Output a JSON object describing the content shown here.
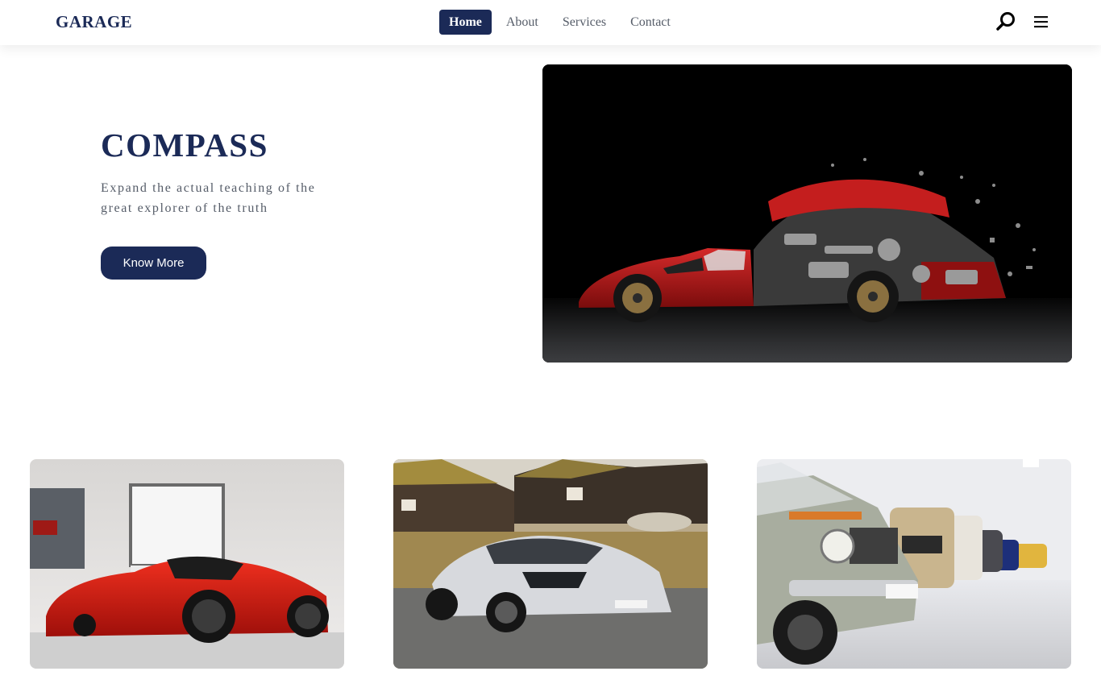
{
  "brand": {
    "logo": "GARAGE"
  },
  "nav": {
    "items": [
      {
        "label": "Home",
        "active": true
      },
      {
        "label": "About",
        "active": false
      },
      {
        "label": "Services",
        "active": false
      },
      {
        "label": "Contact",
        "active": false
      }
    ],
    "icons": [
      "search-icon",
      "menu-icon"
    ]
  },
  "hero": {
    "title": "COMPASS",
    "subtitle_line1": "Expand the actual teaching of the",
    "subtitle_line2": "great explorer of the truth",
    "button_label": "Know More",
    "image": "exploded-red-race-car-photo"
  },
  "gallery": {
    "cards": [
      {
        "image": "red-supercar-showroom-photo"
      },
      {
        "image": "silver-supercar-village-photo"
      },
      {
        "image": "classic-cars-row-museum-photo"
      }
    ]
  },
  "colors": {
    "primary": "#1b2a57",
    "text_muted": "#555c68",
    "background": "#ffffff"
  }
}
